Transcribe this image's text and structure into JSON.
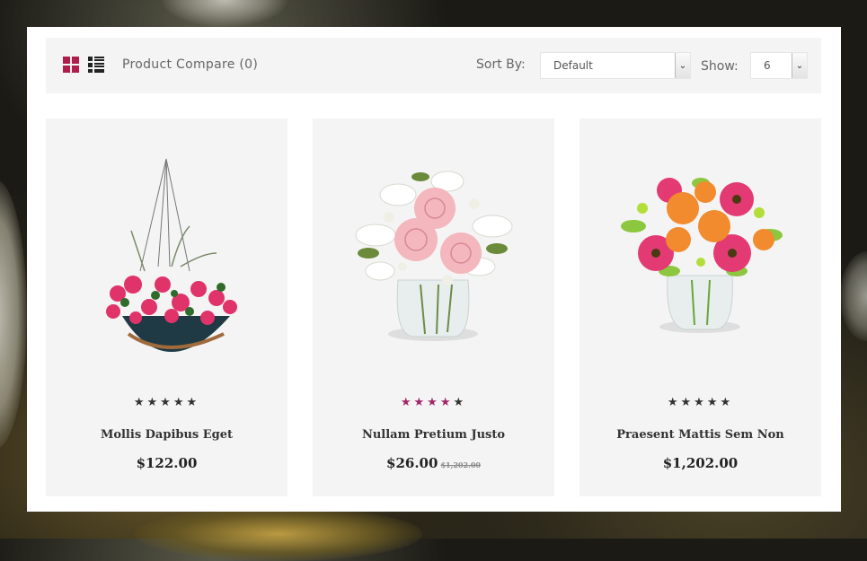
{
  "toolbar": {
    "view_grid_icon": "grid-view-icon",
    "view_list_icon": "list-view-icon",
    "compare_label": "Product Compare (0)",
    "sort_label": "Sort By:",
    "sort_value": "Default",
    "show_label": "Show:",
    "show_value": "6",
    "active_view_color": "#b01d4b"
  },
  "products": [
    {
      "name": "Mollis Dapibus Eget",
      "price": "$122.00",
      "old_price": "",
      "rating": 5,
      "rating_color": "#333333",
      "image": "hanging-basket-flowers"
    },
    {
      "name": "Nullam Pretium Justo",
      "price": "$26.00",
      "old_price": "$1,202.00",
      "rating": 4,
      "rating_color": "#a0256a",
      "image": "pink-roses-vase"
    },
    {
      "name": "Praesent Mattis Sem Non",
      "price": "$1,202.00",
      "old_price": "",
      "rating": 5,
      "rating_color": "#333333",
      "image": "gerbera-roses-vase"
    }
  ]
}
